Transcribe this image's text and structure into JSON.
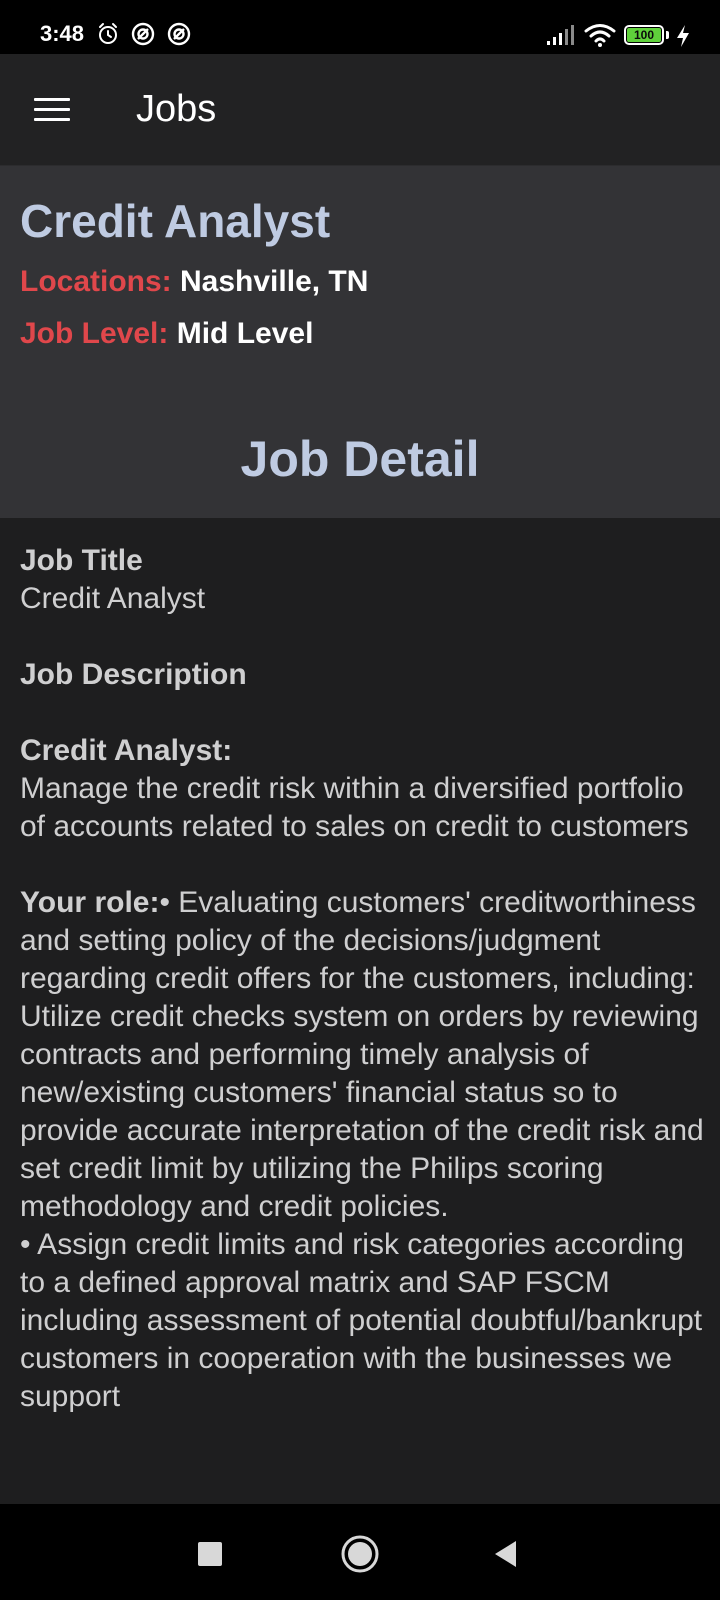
{
  "status_bar": {
    "time": "3:48",
    "left_icons": [
      "alarm-icon",
      "no-disturb-icon",
      "no-disturb-icon"
    ],
    "right_icons": [
      "signal-icon",
      "wifi-icon",
      "battery-icon",
      "charging-icon"
    ],
    "battery_level": "100"
  },
  "app_bar": {
    "title": "Jobs",
    "menu_icon": "hamburger-menu-icon"
  },
  "job": {
    "title": "Credit Analyst",
    "locations_label": "Locations:",
    "locations_value": "Nashville, TN",
    "level_label": "Job Level:",
    "level_value": "Mid Level"
  },
  "detail": {
    "heading": "Job Detail",
    "job_title_label": "Job Title",
    "job_title_value": "Credit Analyst",
    "job_description_label": "Job Description",
    "credit_analyst_label": "Credit Analyst:",
    "credit_analyst_text": " Manage the credit risk within a diversified portfolio of accounts related to sales on credit to customers",
    "your_role_label": "Your role:",
    "your_role_text": "• Evaluating customers' creditworthiness and setting policy of the decisions/judgment regarding credit offers for the customers, including: Utilize credit checks system on orders by reviewing contracts and performing timely analysis of new/existing customers' financial status so to provide accurate interpretation of the credit risk and set credit limit by utilizing the Philips scoring methodology and credit policies.\n• Assign credit limits and risk categories according to a defined approval matrix and SAP FSCM including assessment of potential doubtful/bankrupt customers in cooperation with the businesses we support"
  },
  "nav_bar": {
    "buttons": [
      "recents-square-icon",
      "home-circle-icon",
      "back-triangle-icon"
    ]
  },
  "colors": {
    "accent_label": "#e0474b",
    "heading": "#bfcbe2",
    "background": "#1e1e1f",
    "header_background": "#333336",
    "battery": "#5fd13b"
  }
}
